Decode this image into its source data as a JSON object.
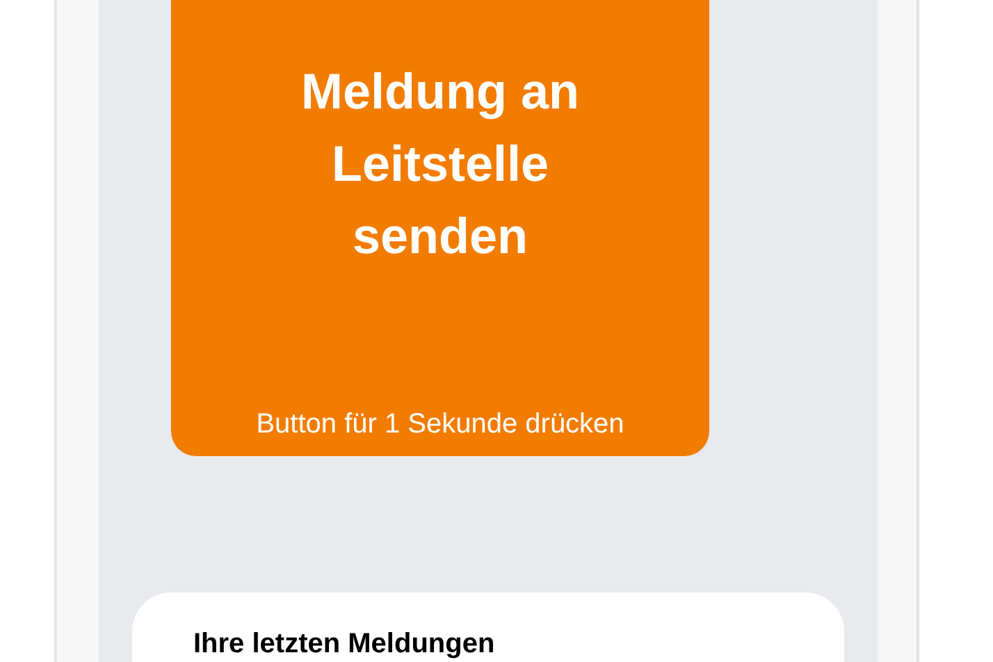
{
  "report_button": {
    "label": "Meldung an Leitstelle senden",
    "hint": "Button für 1 Sekunde drücken"
  },
  "recent_reports": {
    "heading": "Ihre letzten Meldungen"
  }
}
